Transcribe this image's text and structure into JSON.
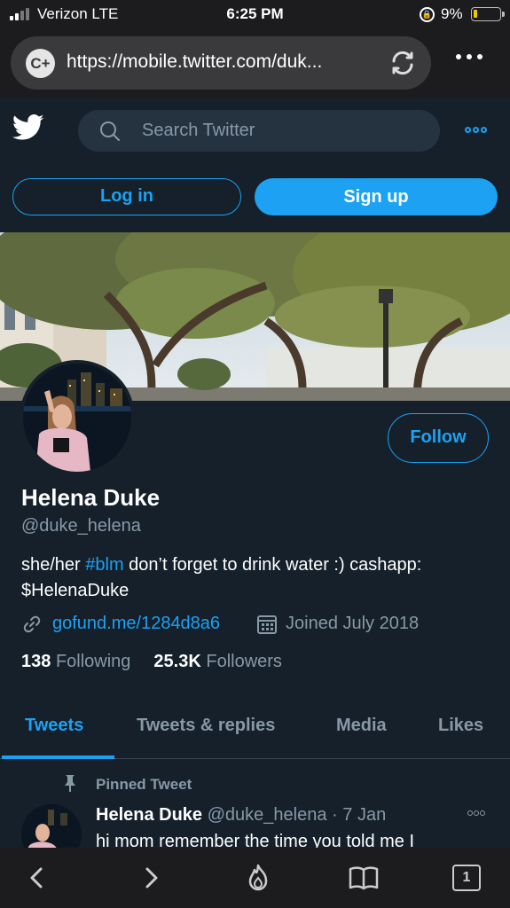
{
  "status_bar": {
    "carrier": "Verizon  LTE",
    "time": "6:25 PM",
    "battery_percent": "9%",
    "icons": [
      "signal-icon",
      "orientation-lock-icon",
      "battery-icon"
    ]
  },
  "browser": {
    "site_icon_label": "C+",
    "url": "https://mobile.twitter.com/duk...",
    "icons": [
      "reload-icon",
      "more-icon"
    ]
  },
  "header": {
    "search_placeholder": "Search Twitter",
    "login_label": "Log in",
    "signup_label": "Sign up",
    "accent_color": "#1da1f2"
  },
  "profile": {
    "follow_label": "Follow",
    "name": "Helena Duke",
    "handle": "@duke_helena",
    "bio_prefix": "she/her ",
    "bio_hashtag": "#blm",
    "bio_suffix": " don’t forget to drink water :) cashapp: $HelenaDuke",
    "link": "gofund.me/1284d8a6",
    "joined": "Joined July 2018",
    "following_count": "138",
    "following_label": "Following",
    "followers_count": "25.3K",
    "followers_label": "Followers"
  },
  "tabs": [
    {
      "label": "Tweets",
      "active": true
    },
    {
      "label": "Tweets & replies",
      "active": false
    },
    {
      "label": "Media",
      "active": false
    },
    {
      "label": "Likes",
      "active": false
    }
  ],
  "pinned_tweet": {
    "pinned_label": "Pinned Tweet",
    "author_name": "Helena Duke",
    "author_handle": "@duke_helena",
    "separator": "·",
    "date": "7 Jan",
    "text": "hi mom remember the time you told me I"
  },
  "toolbar": {
    "icons": [
      "back-icon",
      "forward-icon",
      "brave-icon",
      "bookmarks-icon",
      "tabs-icon"
    ],
    "tab_count": "1"
  }
}
